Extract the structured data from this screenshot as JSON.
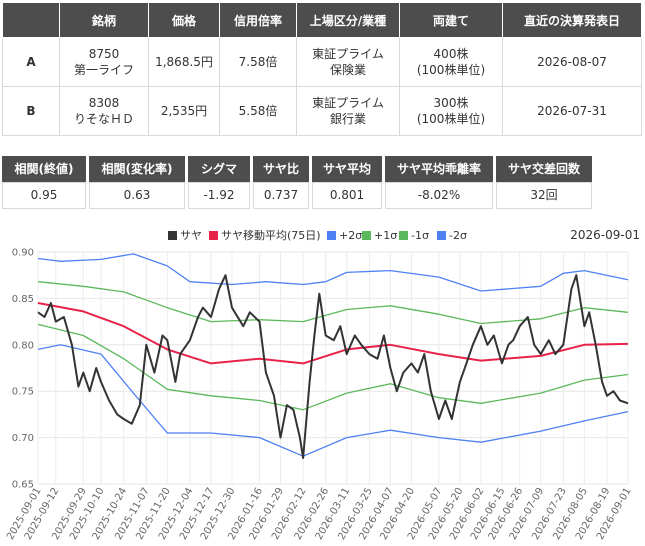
{
  "pair_table": {
    "headers": [
      "",
      "銘柄",
      "価格",
      "信用倍率",
      "上場区分/業種",
      "両建て",
      "直近の決算発表日"
    ],
    "rows": [
      {
        "label": "A",
        "code": "8750",
        "name": "第一ライフ",
        "price": "1,868.5円",
        "margin_ratio": "7.58倍",
        "market": "東証プライム",
        "sector": "保険業",
        "shares": "400株",
        "unit": "(100株単位)",
        "earnings_date": "2026-08-07"
      },
      {
        "label": "B",
        "code": "8308",
        "name": "りそなＨＤ",
        "price": "2,535円",
        "margin_ratio": "5.58倍",
        "market": "東証プライム",
        "sector": "銀行業",
        "shares": "300株",
        "unit": "(100株単位)",
        "earnings_date": "2026-07-31"
      }
    ]
  },
  "stats": [
    {
      "label": "相関(終値)",
      "value": "0.95"
    },
    {
      "label": "相関(変化率)",
      "value": "0.63"
    },
    {
      "label": "シグマ",
      "value": "-1.92"
    },
    {
      "label": "サヤ比",
      "value": "0.737"
    },
    {
      "label": "サヤ平均",
      "value": "0.801"
    },
    {
      "label": "サヤ平均乖離率",
      "value": "-8.02%"
    },
    {
      "label": "サヤ交差回数",
      "value": "32回"
    }
  ],
  "chart_data": {
    "type": "line",
    "date_label": "2026-09-01",
    "ylim": [
      0.65,
      0.9
    ],
    "yticks": [
      "0.65",
      "0.70",
      "0.75",
      "0.80",
      "0.85",
      "0.90"
    ],
    "x_range": [
      "2025-09-01",
      "2026-09-01"
    ],
    "xticks": [
      "2025-09-01",
      "2025-09-12",
      "2025-09-29",
      "2025-10-10",
      "2025-10-24",
      "2025-11-07",
      "2025-11-20",
      "2025-12-04",
      "2025-12-17",
      "2025-12-30",
      "2026-01-16",
      "2026-01-29",
      "2026-02-12",
      "2026-02-26",
      "2026-03-11",
      "2026-03-25",
      "2026-04-07",
      "2026-04-20",
      "2026-05-07",
      "2026-05-20",
      "2026-06-02",
      "2026-06-15",
      "2026-06-26",
      "2026-07-09",
      "2026-07-23",
      "2026-08-05",
      "2026-08-19",
      "2026-09-01"
    ],
    "legend_position": "top",
    "series": [
      {
        "name": "サヤ",
        "color": "#333333",
        "width": 2,
        "points": [
          [
            "2025-09-01",
            0.835
          ],
          [
            "2025-09-05",
            0.83
          ],
          [
            "2025-09-09",
            0.845
          ],
          [
            "2025-09-12",
            0.825
          ],
          [
            "2025-09-17",
            0.83
          ],
          [
            "2025-09-22",
            0.8
          ],
          [
            "2025-09-26",
            0.755
          ],
          [
            "2025-09-29",
            0.77
          ],
          [
            "2025-10-03",
            0.75
          ],
          [
            "2025-10-07",
            0.775
          ],
          [
            "2025-10-10",
            0.76
          ],
          [
            "2025-10-15",
            0.74
          ],
          [
            "2025-10-20",
            0.725
          ],
          [
            "2025-10-24",
            0.72
          ],
          [
            "2025-10-29",
            0.715
          ],
          [
            "2025-11-03",
            0.735
          ],
          [
            "2025-11-07",
            0.8
          ],
          [
            "2025-11-12",
            0.77
          ],
          [
            "2025-11-17",
            0.81
          ],
          [
            "2025-11-20",
            0.805
          ],
          [
            "2025-11-25",
            0.76
          ],
          [
            "2025-11-28",
            0.79
          ],
          [
            "2025-12-04",
            0.805
          ],
          [
            "2025-12-09",
            0.83
          ],
          [
            "2025-12-12",
            0.84
          ],
          [
            "2025-12-17",
            0.83
          ],
          [
            "2025-12-22",
            0.86
          ],
          [
            "2025-12-26",
            0.875
          ],
          [
            "2025-12-30",
            0.84
          ],
          [
            "2026-01-06",
            0.82
          ],
          [
            "2026-01-10",
            0.835
          ],
          [
            "2026-01-16",
            0.825
          ],
          [
            "2026-01-20",
            0.77
          ],
          [
            "2026-01-25",
            0.745
          ],
          [
            "2026-01-29",
            0.7
          ],
          [
            "2026-02-02",
            0.735
          ],
          [
            "2026-02-06",
            0.73
          ],
          [
            "2026-02-10",
            0.7
          ],
          [
            "2026-02-12",
            0.678
          ],
          [
            "2026-02-16",
            0.76
          ],
          [
            "2026-02-19",
            0.81
          ],
          [
            "2026-02-22",
            0.855
          ],
          [
            "2026-02-26",
            0.81
          ],
          [
            "2026-03-03",
            0.805
          ],
          [
            "2026-03-07",
            0.82
          ],
          [
            "2026-03-11",
            0.79
          ],
          [
            "2026-03-16",
            0.81
          ],
          [
            "2026-03-20",
            0.8
          ],
          [
            "2026-03-25",
            0.79
          ],
          [
            "2026-03-30",
            0.785
          ],
          [
            "2026-04-03",
            0.81
          ],
          [
            "2026-04-07",
            0.775
          ],
          [
            "2026-04-11",
            0.75
          ],
          [
            "2026-04-15",
            0.77
          ],
          [
            "2026-04-20",
            0.78
          ],
          [
            "2026-04-24",
            0.77
          ],
          [
            "2026-04-28",
            0.79
          ],
          [
            "2026-05-02",
            0.75
          ],
          [
            "2026-05-07",
            0.72
          ],
          [
            "2026-05-11",
            0.74
          ],
          [
            "2026-05-15",
            0.72
          ],
          [
            "2026-05-20",
            0.76
          ],
          [
            "2026-05-24",
            0.78
          ],
          [
            "2026-05-28",
            0.8
          ],
          [
            "2026-06-02",
            0.82
          ],
          [
            "2026-06-06",
            0.8
          ],
          [
            "2026-06-10",
            0.81
          ],
          [
            "2026-06-15",
            0.78
          ],
          [
            "2026-06-19",
            0.8
          ],
          [
            "2026-06-22",
            0.805
          ],
          [
            "2026-06-26",
            0.82
          ],
          [
            "2026-07-01",
            0.83
          ],
          [
            "2026-07-05",
            0.8
          ],
          [
            "2026-07-09",
            0.79
          ],
          [
            "2026-07-14",
            0.805
          ],
          [
            "2026-07-18",
            0.79
          ],
          [
            "2026-07-23",
            0.8
          ],
          [
            "2026-07-28",
            0.86
          ],
          [
            "2026-07-31",
            0.875
          ],
          [
            "2026-08-05",
            0.82
          ],
          [
            "2026-08-08",
            0.835
          ],
          [
            "2026-08-12",
            0.8
          ],
          [
            "2026-08-16",
            0.76
          ],
          [
            "2026-08-19",
            0.745
          ],
          [
            "2026-08-23",
            0.75
          ],
          [
            "2026-08-27",
            0.74
          ],
          [
            "2026-09-01",
            0.737
          ]
        ]
      },
      {
        "name": "サヤ移動平均(75日)",
        "color": "#e8234a",
        "width": 2,
        "points": [
          [
            "2025-09-01",
            0.845
          ],
          [
            "2025-09-29",
            0.836
          ],
          [
            "2025-10-24",
            0.82
          ],
          [
            "2025-11-20",
            0.795
          ],
          [
            "2025-12-17",
            0.78
          ],
          [
            "2026-01-16",
            0.785
          ],
          [
            "2026-02-12",
            0.78
          ],
          [
            "2026-03-11",
            0.795
          ],
          [
            "2026-04-07",
            0.8
          ],
          [
            "2026-05-07",
            0.79
          ],
          [
            "2026-06-02",
            0.783
          ],
          [
            "2026-07-09",
            0.788
          ],
          [
            "2026-08-05",
            0.8
          ],
          [
            "2026-09-01",
            0.801
          ]
        ]
      },
      {
        "name": "+2σ",
        "color": "#4f81f5",
        "width": 1.3,
        "points": [
          [
            "2025-09-01",
            0.893
          ],
          [
            "2025-09-15",
            0.89
          ],
          [
            "2025-10-10",
            0.892
          ],
          [
            "2025-10-30",
            0.898
          ],
          [
            "2025-11-20",
            0.885
          ],
          [
            "2025-12-04",
            0.868
          ],
          [
            "2025-12-30",
            0.865
          ],
          [
            "2026-01-20",
            0.868
          ],
          [
            "2026-02-12",
            0.865
          ],
          [
            "2026-02-26",
            0.868
          ],
          [
            "2026-03-11",
            0.878
          ],
          [
            "2026-04-07",
            0.88
          ],
          [
            "2026-05-07",
            0.873
          ],
          [
            "2026-06-02",
            0.858
          ],
          [
            "2026-07-09",
            0.863
          ],
          [
            "2026-07-23",
            0.877
          ],
          [
            "2026-08-05",
            0.88
          ],
          [
            "2026-09-01",
            0.87
          ]
        ]
      },
      {
        "name": "+1σ",
        "color": "#5cb85c",
        "width": 1.3,
        "points": [
          [
            "2025-09-01",
            0.868
          ],
          [
            "2025-09-29",
            0.863
          ],
          [
            "2025-10-24",
            0.857
          ],
          [
            "2025-11-20",
            0.84
          ],
          [
            "2025-12-17",
            0.825
          ],
          [
            "2026-01-16",
            0.827
          ],
          [
            "2026-02-12",
            0.825
          ],
          [
            "2026-03-11",
            0.838
          ],
          [
            "2026-04-07",
            0.842
          ],
          [
            "2026-05-07",
            0.833
          ],
          [
            "2026-06-02",
            0.823
          ],
          [
            "2026-07-09",
            0.828
          ],
          [
            "2026-08-05",
            0.84
          ],
          [
            "2026-09-01",
            0.835
          ]
        ]
      },
      {
        "name": "-1σ",
        "color": "#5cb85c",
        "width": 1.3,
        "points": [
          [
            "2025-09-01",
            0.822
          ],
          [
            "2025-09-29",
            0.81
          ],
          [
            "2025-10-24",
            0.785
          ],
          [
            "2025-11-20",
            0.752
          ],
          [
            "2025-12-17",
            0.745
          ],
          [
            "2026-01-16",
            0.74
          ],
          [
            "2026-02-12",
            0.73
          ],
          [
            "2026-03-11",
            0.748
          ],
          [
            "2026-04-07",
            0.758
          ],
          [
            "2026-05-07",
            0.743
          ],
          [
            "2026-06-02",
            0.737
          ],
          [
            "2026-07-09",
            0.748
          ],
          [
            "2026-08-05",
            0.762
          ],
          [
            "2026-09-01",
            0.768
          ]
        ]
      },
      {
        "name": "-2σ",
        "color": "#4f81f5",
        "width": 1.3,
        "points": [
          [
            "2025-09-01",
            0.795
          ],
          [
            "2025-09-15",
            0.8
          ],
          [
            "2025-10-10",
            0.79
          ],
          [
            "2025-10-30",
            0.748
          ],
          [
            "2025-11-20",
            0.705
          ],
          [
            "2025-12-17",
            0.705
          ],
          [
            "2026-01-16",
            0.7
          ],
          [
            "2026-02-12",
            0.68
          ],
          [
            "2026-03-11",
            0.7
          ],
          [
            "2026-04-07",
            0.708
          ],
          [
            "2026-05-07",
            0.7
          ],
          [
            "2026-06-02",
            0.695
          ],
          [
            "2026-07-09",
            0.707
          ],
          [
            "2026-08-05",
            0.718
          ],
          [
            "2026-09-01",
            0.728
          ]
        ]
      }
    ]
  }
}
